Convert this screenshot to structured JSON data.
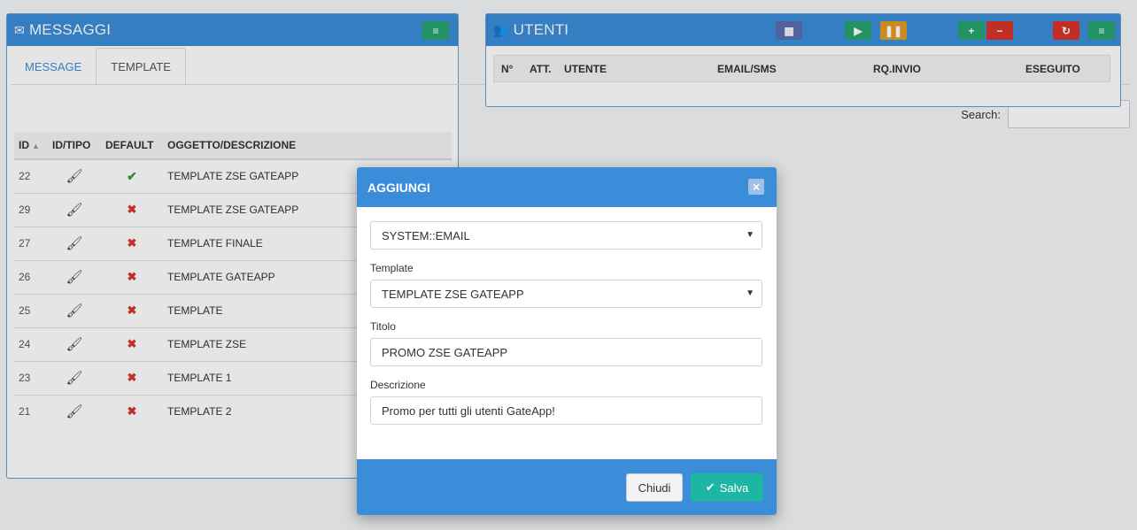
{
  "messaggi": {
    "title": "MESSAGGI",
    "tabs": [
      {
        "label": "MESSAGE"
      },
      {
        "label": "TEMPLATE"
      }
    ],
    "search_label": "Search:",
    "columns": [
      "ID",
      "ID/TIPO",
      "DEFAULT",
      "OGGETTO/DESCRIZIONE"
    ],
    "sort_indicator": "▲",
    "rows": [
      {
        "id": "22",
        "default": "check",
        "oggetto": "TEMPLATE ZSE GATEAPP"
      },
      {
        "id": "29",
        "default": "cross",
        "oggetto": "TEMPLATE ZSE GATEAPP"
      },
      {
        "id": "27",
        "default": "cross",
        "oggetto": "TEMPLATE FINALE"
      },
      {
        "id": "26",
        "default": "cross",
        "oggetto": "TEMPLATE GATEAPP"
      },
      {
        "id": "25",
        "default": "cross",
        "oggetto": "TEMPLATE"
      },
      {
        "id": "24",
        "default": "cross",
        "oggetto": "TEMPLATE ZSE"
      },
      {
        "id": "23",
        "default": "cross",
        "oggetto": "TEMPLATE 1"
      },
      {
        "id": "21",
        "default": "cross",
        "oggetto": "TEMPLATE 2"
      }
    ]
  },
  "utenti": {
    "title": "UTENTI",
    "columns": [
      "N°",
      "ATT.",
      "UTENTE",
      "EMAIL/SMS",
      "RQ.INVIO",
      "ESEGUITO"
    ]
  },
  "modal": {
    "title": "AGGIUNGI",
    "close_glyph": "×",
    "type_value": "SYSTEM::EMAIL",
    "template_label": "Template",
    "template_value": "TEMPLATE ZSE GATEAPP",
    "titolo_label": "Titolo",
    "titolo_value": "PROMO ZSE GATEAPP",
    "descrizione_label": "Descrizione",
    "descrizione_value": "Promo per tutti gli utenti GateApp!",
    "close_button": "Chiudi",
    "save_button": "Salva"
  },
  "colors": {
    "primary": "#3c8dd9",
    "success": "#3a9a3a",
    "danger": "#d9342b",
    "teal": "#1fb5a3",
    "warning": "#e09a25"
  },
  "icons": {
    "messaggi": "envelope-icon",
    "utenti": "users-icon",
    "edit": "brush-icon",
    "default_yes": "check-icon",
    "default_no": "cross-icon"
  }
}
